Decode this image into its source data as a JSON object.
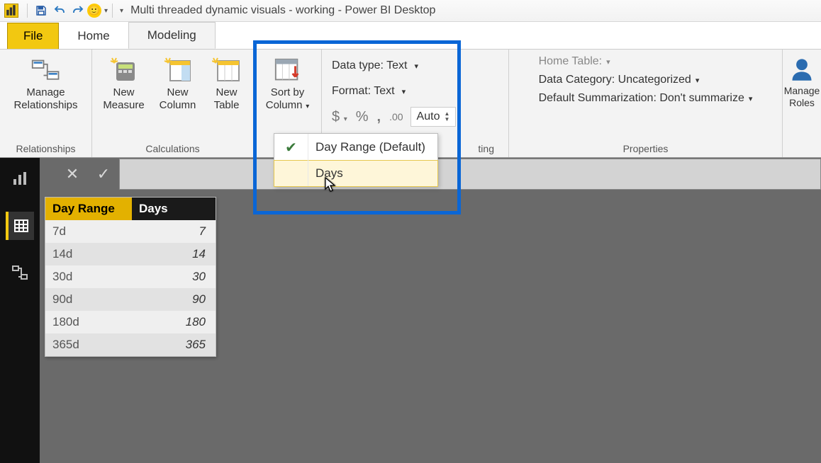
{
  "titlebar": {
    "app_icon_text": "",
    "title": "Multi threaded dynamic visuals - working - Power BI Desktop"
  },
  "tabs": {
    "file": "File",
    "home": "Home",
    "modeling": "Modeling"
  },
  "ribbon": {
    "relationships": {
      "manage": "Manage\nRelationships",
      "group_label": "Relationships"
    },
    "calculations": {
      "new_measure": "New\nMeasure",
      "new_column": "New\nColumn",
      "new_table": "New\nTable",
      "group_label": "Calculations"
    },
    "sort": {
      "label": "Sort by\nColumn",
      "menu_default": "Day Range (Default)",
      "menu_days": "Days"
    },
    "formatting": {
      "data_type_label": "Data type: Text",
      "format_label": "Format: Text",
      "auto_label": "Auto",
      "group_label_partial": "ting"
    },
    "properties": {
      "home_table": "Home Table:",
      "data_category": "Data Category: Uncategorized",
      "default_summarization": "Default Summarization: Don't summarize",
      "group_label": "Properties"
    },
    "security": {
      "label": "Manage\nRoles"
    }
  },
  "table": {
    "headers": {
      "range": "Day Range",
      "days": "Days"
    },
    "rows": [
      {
        "range": "7d",
        "days": "7"
      },
      {
        "range": "14d",
        "days": "14"
      },
      {
        "range": "30d",
        "days": "30"
      },
      {
        "range": "90d",
        "days": "90"
      },
      {
        "range": "180d",
        "days": "180"
      },
      {
        "range": "365d",
        "days": "365"
      }
    ]
  }
}
